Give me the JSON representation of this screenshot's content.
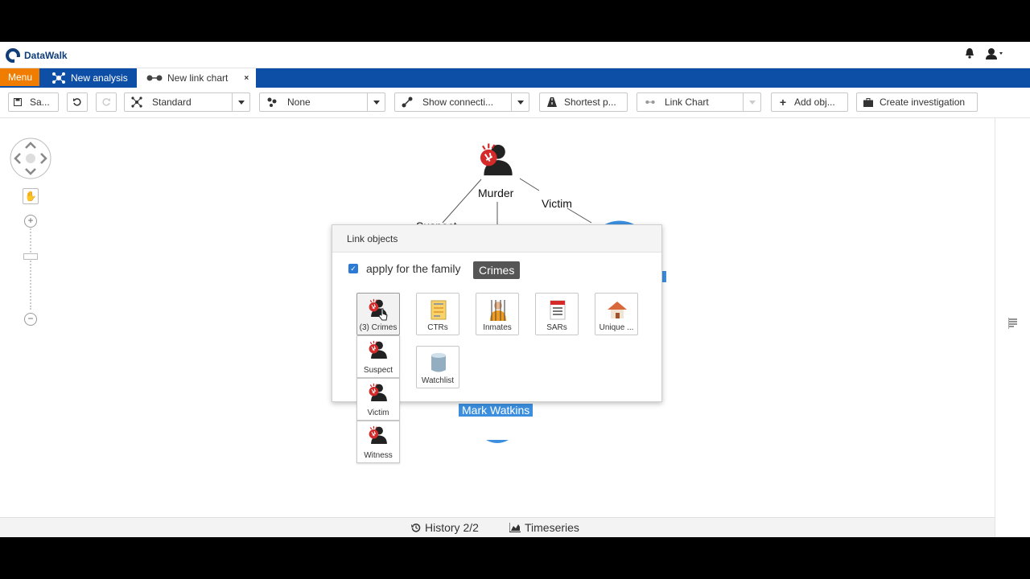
{
  "app": {
    "name": "DataWalk"
  },
  "tabs": {
    "menu": "Menu",
    "analysis": "New analysis",
    "link_chart": "New link chart",
    "close": "×"
  },
  "toolbar": {
    "save": "Sa...",
    "layout": "Standard",
    "grouping": "None",
    "connections": "Show connecti...",
    "shortest_path": "Shortest p...",
    "view": "Link Chart",
    "add_objects": "Add obj...",
    "create_investigation": "Create investigation"
  },
  "graph": {
    "nodes": {
      "murder": "Murder",
      "mark": "Mark Watkins"
    },
    "edges": {
      "victim": "Victim",
      "suspect": "Suspect"
    }
  },
  "dialog": {
    "title": "Link objects",
    "apply_label": "apply for the family",
    "family_tag": "Crimes",
    "apply_checked": true,
    "tiles": [
      {
        "label": "(3) Crimes",
        "icon": "crime-icon"
      },
      {
        "label": "CTRs",
        "icon": "ctr-document-icon"
      },
      {
        "label": "Inmates",
        "icon": "inmate-icon"
      },
      {
        "label": "SARs",
        "icon": "sar-document-icon"
      },
      {
        "label": "Unique ...",
        "icon": "house-icon"
      },
      {
        "label": "Watchlist",
        "icon": "database-icon"
      }
    ],
    "crime_subtypes": [
      {
        "label": "Suspect"
      },
      {
        "label": "Victim"
      },
      {
        "label": "Witness"
      }
    ]
  },
  "bottom": {
    "history": "History 2/2",
    "timeseries": "Timeseries"
  },
  "colors": {
    "brand": "#0f3d7a",
    "tabbar": "#0d4fa6",
    "menu": "#f07d00",
    "selection": "#3b8fde",
    "crime_red": "#d42a2a"
  }
}
